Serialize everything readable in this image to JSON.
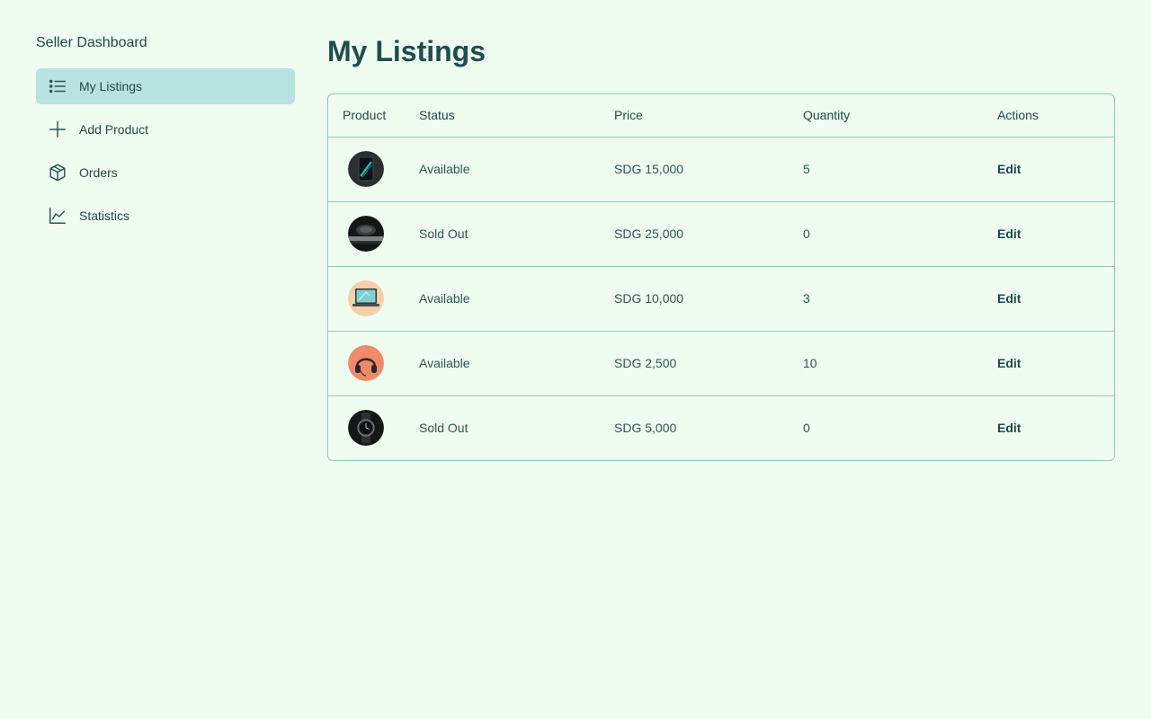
{
  "sidebar": {
    "title": "Seller Dashboard",
    "items": [
      {
        "label": "My Listings",
        "icon": "list-icon",
        "active": true
      },
      {
        "label": "Add Product",
        "icon": "plus-icon",
        "active": false
      },
      {
        "label": "Orders",
        "icon": "box-icon",
        "active": false
      },
      {
        "label": "Statistics",
        "icon": "chart-icon",
        "active": false
      }
    ]
  },
  "main": {
    "title": "My Listings",
    "table": {
      "headers": [
        "Product",
        "Status",
        "Price",
        "Quantity",
        "Actions"
      ],
      "rows": [
        {
          "thumb": "smartphone",
          "status": "Available",
          "price": "SDG 15,000",
          "quantity": "5",
          "action": "Edit"
        },
        {
          "thumb": "speaker",
          "status": "Sold Out",
          "price": "SDG 25,000",
          "quantity": "0",
          "action": "Edit"
        },
        {
          "thumb": "laptop",
          "status": "Available",
          "price": "SDG 10,000",
          "quantity": "3",
          "action": "Edit"
        },
        {
          "thumb": "headphones",
          "status": "Available",
          "price": "SDG 2,500",
          "quantity": "10",
          "action": "Edit"
        },
        {
          "thumb": "smartwatch",
          "status": "Sold Out",
          "price": "SDG 5,000",
          "quantity": "0",
          "action": "Edit"
        }
      ]
    }
  },
  "colors": {
    "background": "#effdf0",
    "active_nav": "#b8e3e0",
    "border": "#8cc9c3",
    "text": "#1f4a4a"
  }
}
